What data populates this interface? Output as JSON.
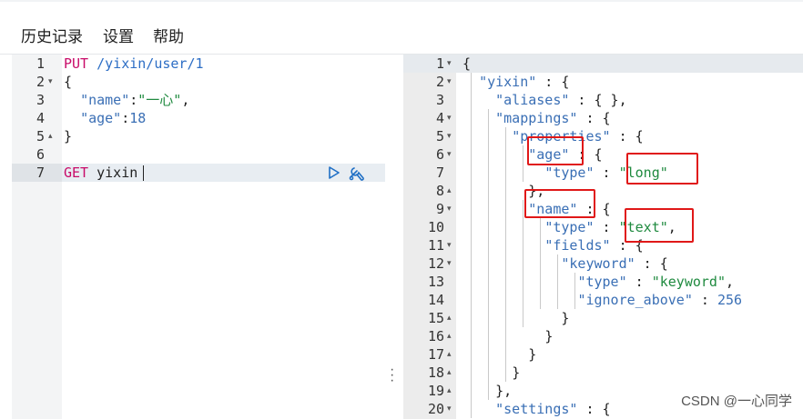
{
  "menu": [
    "历史记录",
    "设置",
    "帮助"
  ],
  "left_editor": {
    "lines": [
      {
        "num": "1",
        "fold": "",
        "tokens": [
          [
            "PUT ",
            "kw"
          ],
          [
            "/yixin/user/1",
            "path"
          ]
        ]
      },
      {
        "num": "2",
        "fold": "▾",
        "tokens": [
          [
            "{",
            "punc"
          ]
        ]
      },
      {
        "num": "3",
        "fold": "",
        "tokens": [
          [
            "  ",
            "punc"
          ],
          [
            "\"name\"",
            "key"
          ],
          [
            ":",
            "punc"
          ],
          [
            "\"一心\"",
            "str"
          ],
          [
            ",",
            "punc"
          ]
        ]
      },
      {
        "num": "4",
        "fold": "",
        "tokens": [
          [
            "  ",
            "punc"
          ],
          [
            "\"age\"",
            "key"
          ],
          [
            ":",
            "punc"
          ],
          [
            "18",
            "num"
          ]
        ]
      },
      {
        "num": "5",
        "fold": "▴",
        "tokens": [
          [
            "}",
            "punc"
          ]
        ]
      },
      {
        "num": "6",
        "fold": "",
        "tokens": []
      },
      {
        "num": "7",
        "fold": "",
        "tokens": [
          [
            "GET ",
            "kw"
          ],
          [
            "yixin",
            "punc"
          ]
        ]
      }
    ]
  },
  "right_editor": {
    "lines": [
      {
        "num": "1",
        "fold": "▾",
        "tokens": [
          [
            "{",
            "punc"
          ]
        ]
      },
      {
        "num": "2",
        "fold": "▾",
        "tokens": [
          [
            "  ",
            "punc"
          ],
          [
            "\"yixin\"",
            "key"
          ],
          [
            " : {",
            "punc"
          ]
        ]
      },
      {
        "num": "3",
        "fold": "",
        "tokens": [
          [
            "    ",
            "punc"
          ],
          [
            "\"aliases\"",
            "key"
          ],
          [
            " : { },",
            "punc"
          ]
        ]
      },
      {
        "num": "4",
        "fold": "▾",
        "tokens": [
          [
            "    ",
            "punc"
          ],
          [
            "\"mappings\"",
            "key"
          ],
          [
            " : {",
            "punc"
          ]
        ]
      },
      {
        "num": "5",
        "fold": "▾",
        "tokens": [
          [
            "      ",
            "punc"
          ],
          [
            "\"properties\"",
            "key"
          ],
          [
            " : {",
            "punc"
          ]
        ]
      },
      {
        "num": "6",
        "fold": "▾",
        "tokens": [
          [
            "        ",
            "punc"
          ],
          [
            "\"age\"",
            "key"
          ],
          [
            " : {",
            "punc"
          ]
        ]
      },
      {
        "num": "7",
        "fold": "",
        "tokens": [
          [
            "          ",
            "punc"
          ],
          [
            "\"type\"",
            "key"
          ],
          [
            " : ",
            "punc"
          ],
          [
            "\"long\"",
            "str"
          ]
        ]
      },
      {
        "num": "8",
        "fold": "▴",
        "tokens": [
          [
            "        ",
            "punc"
          ],
          [
            "},",
            "punc"
          ]
        ]
      },
      {
        "num": "9",
        "fold": "▾",
        "tokens": [
          [
            "        ",
            "punc"
          ],
          [
            "\"name\"",
            "key"
          ],
          [
            " : {",
            "punc"
          ]
        ]
      },
      {
        "num": "10",
        "fold": "",
        "tokens": [
          [
            "          ",
            "punc"
          ],
          [
            "\"type\"",
            "key"
          ],
          [
            " : ",
            "punc"
          ],
          [
            "\"text\"",
            "str"
          ],
          [
            ",",
            "punc"
          ]
        ]
      },
      {
        "num": "11",
        "fold": "▾",
        "tokens": [
          [
            "          ",
            "punc"
          ],
          [
            "\"fields\"",
            "key"
          ],
          [
            " : {",
            "punc"
          ]
        ]
      },
      {
        "num": "12",
        "fold": "▾",
        "tokens": [
          [
            "            ",
            "punc"
          ],
          [
            "\"keyword\"",
            "key"
          ],
          [
            " : {",
            "punc"
          ]
        ]
      },
      {
        "num": "13",
        "fold": "",
        "tokens": [
          [
            "              ",
            "punc"
          ],
          [
            "\"type\"",
            "key"
          ],
          [
            " : ",
            "punc"
          ],
          [
            "\"keyword\"",
            "str"
          ],
          [
            ",",
            "punc"
          ]
        ]
      },
      {
        "num": "14",
        "fold": "",
        "tokens": [
          [
            "              ",
            "punc"
          ],
          [
            "\"ignore_above\"",
            "key"
          ],
          [
            " : ",
            "punc"
          ],
          [
            "256",
            "num"
          ]
        ]
      },
      {
        "num": "15",
        "fold": "▴",
        "tokens": [
          [
            "            ",
            "punc"
          ],
          [
            "}",
            "punc"
          ]
        ]
      },
      {
        "num": "16",
        "fold": "▴",
        "tokens": [
          [
            "          ",
            "punc"
          ],
          [
            "}",
            "punc"
          ]
        ]
      },
      {
        "num": "17",
        "fold": "▴",
        "tokens": [
          [
            "        ",
            "punc"
          ],
          [
            "}",
            "punc"
          ]
        ]
      },
      {
        "num": "18",
        "fold": "▴",
        "tokens": [
          [
            "      ",
            "punc"
          ],
          [
            "}",
            "punc"
          ]
        ]
      },
      {
        "num": "19",
        "fold": "▴",
        "tokens": [
          [
            "    ",
            "punc"
          ],
          [
            "},",
            "punc"
          ]
        ]
      },
      {
        "num": "20",
        "fold": "▾",
        "tokens": [
          [
            "    ",
            "punc"
          ],
          [
            "\"settings\"",
            "key"
          ],
          [
            " : {",
            "punc"
          ]
        ]
      }
    ]
  },
  "watermark": "CSDN @一心同学",
  "colors": {
    "highlight_box": "#e01818",
    "keyword": "#c80a68",
    "key": "#3a6fb5",
    "string": "#1f8a3f"
  }
}
